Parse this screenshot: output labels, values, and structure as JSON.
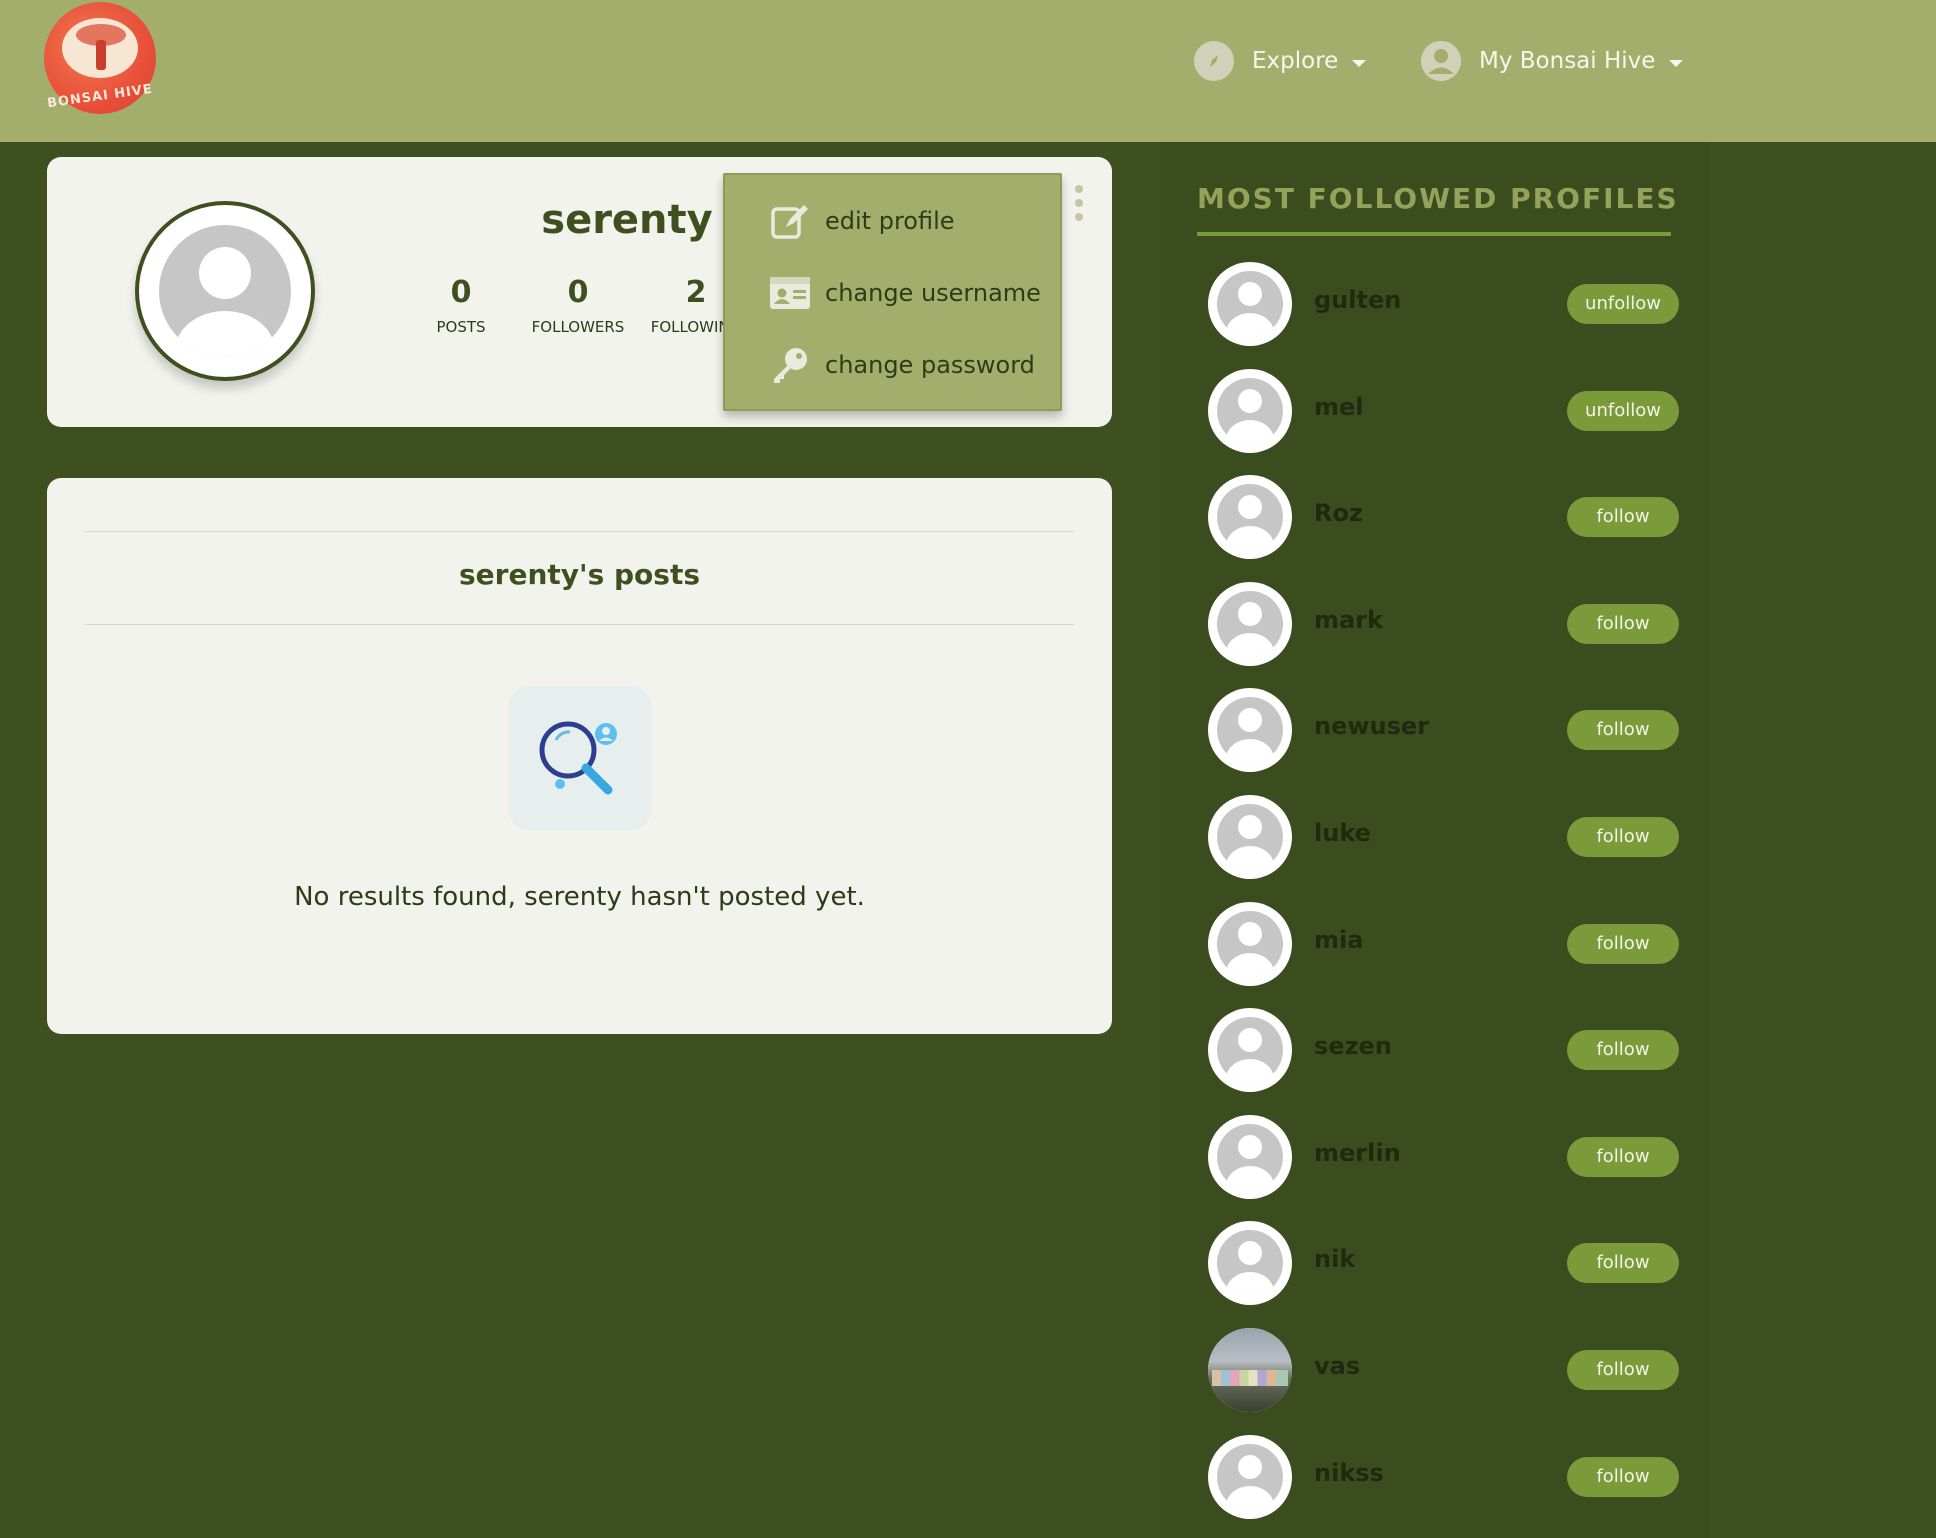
{
  "navbar": {
    "logo_text": "BONSAI HIVE",
    "explore_label": "Explore",
    "my_hive_label": "My Bonsai Hive"
  },
  "profile": {
    "username": "serenty",
    "stats": {
      "posts": {
        "value": "0",
        "label": "POSTS"
      },
      "followers": {
        "value": "0",
        "label": "FOLLOWERS"
      },
      "following": {
        "value": "2",
        "label": "FOLLOWING"
      }
    }
  },
  "menu": {
    "edit_profile": "edit profile",
    "change_username": "change username",
    "change_password": "change password"
  },
  "posts": {
    "title": "serenty's posts",
    "empty_message": "No results found, serenty hasn't posted yet."
  },
  "sidebar": {
    "title": "MOST FOLLOWED PROFILES",
    "profiles": [
      {
        "name": "gulten",
        "action": "unfollow"
      },
      {
        "name": "mel",
        "action": "unfollow"
      },
      {
        "name": "Roz",
        "action": "follow"
      },
      {
        "name": "mark",
        "action": "follow"
      },
      {
        "name": "newuser",
        "action": "follow"
      },
      {
        "name": "luke",
        "action": "follow"
      },
      {
        "name": "mia",
        "action": "follow"
      },
      {
        "name": "sezen",
        "action": "follow"
      },
      {
        "name": "merlin",
        "action": "follow"
      },
      {
        "name": "nik",
        "action": "follow"
      },
      {
        "name": "vas",
        "action": "follow"
      },
      {
        "name": "nikss",
        "action": "follow"
      }
    ]
  },
  "colors": {
    "navbar": "#a4ae6c",
    "background": "#3e5020",
    "card": "#f3f3ee",
    "accent": "#7b9a3a",
    "heading": "#95a25a"
  }
}
